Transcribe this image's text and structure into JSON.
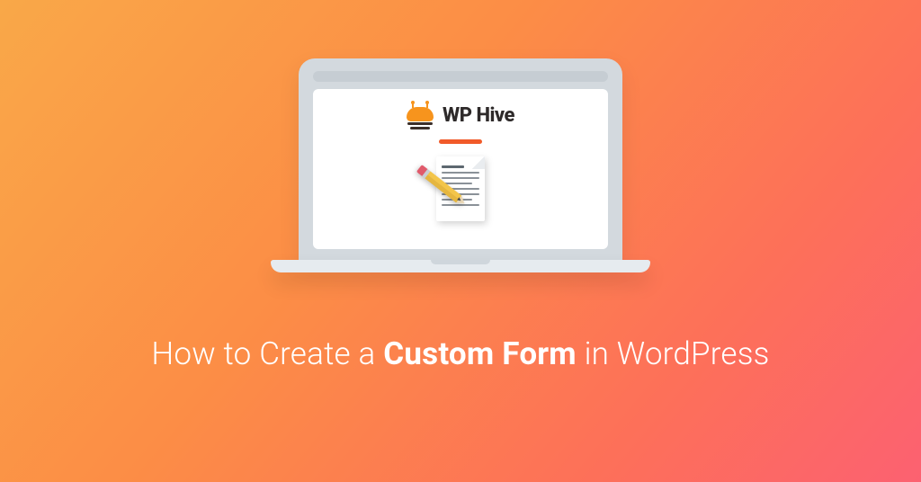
{
  "logo": {
    "name": "WP Hive"
  },
  "headline": {
    "before": "How to Create a ",
    "bold": "Custom Form",
    "after": " in WordPress"
  },
  "colors": {
    "accent": "#f15a29"
  },
  "icons": {
    "logo": "bee-logo-icon",
    "doc": "document-icon",
    "pencil": "pencil-icon"
  }
}
